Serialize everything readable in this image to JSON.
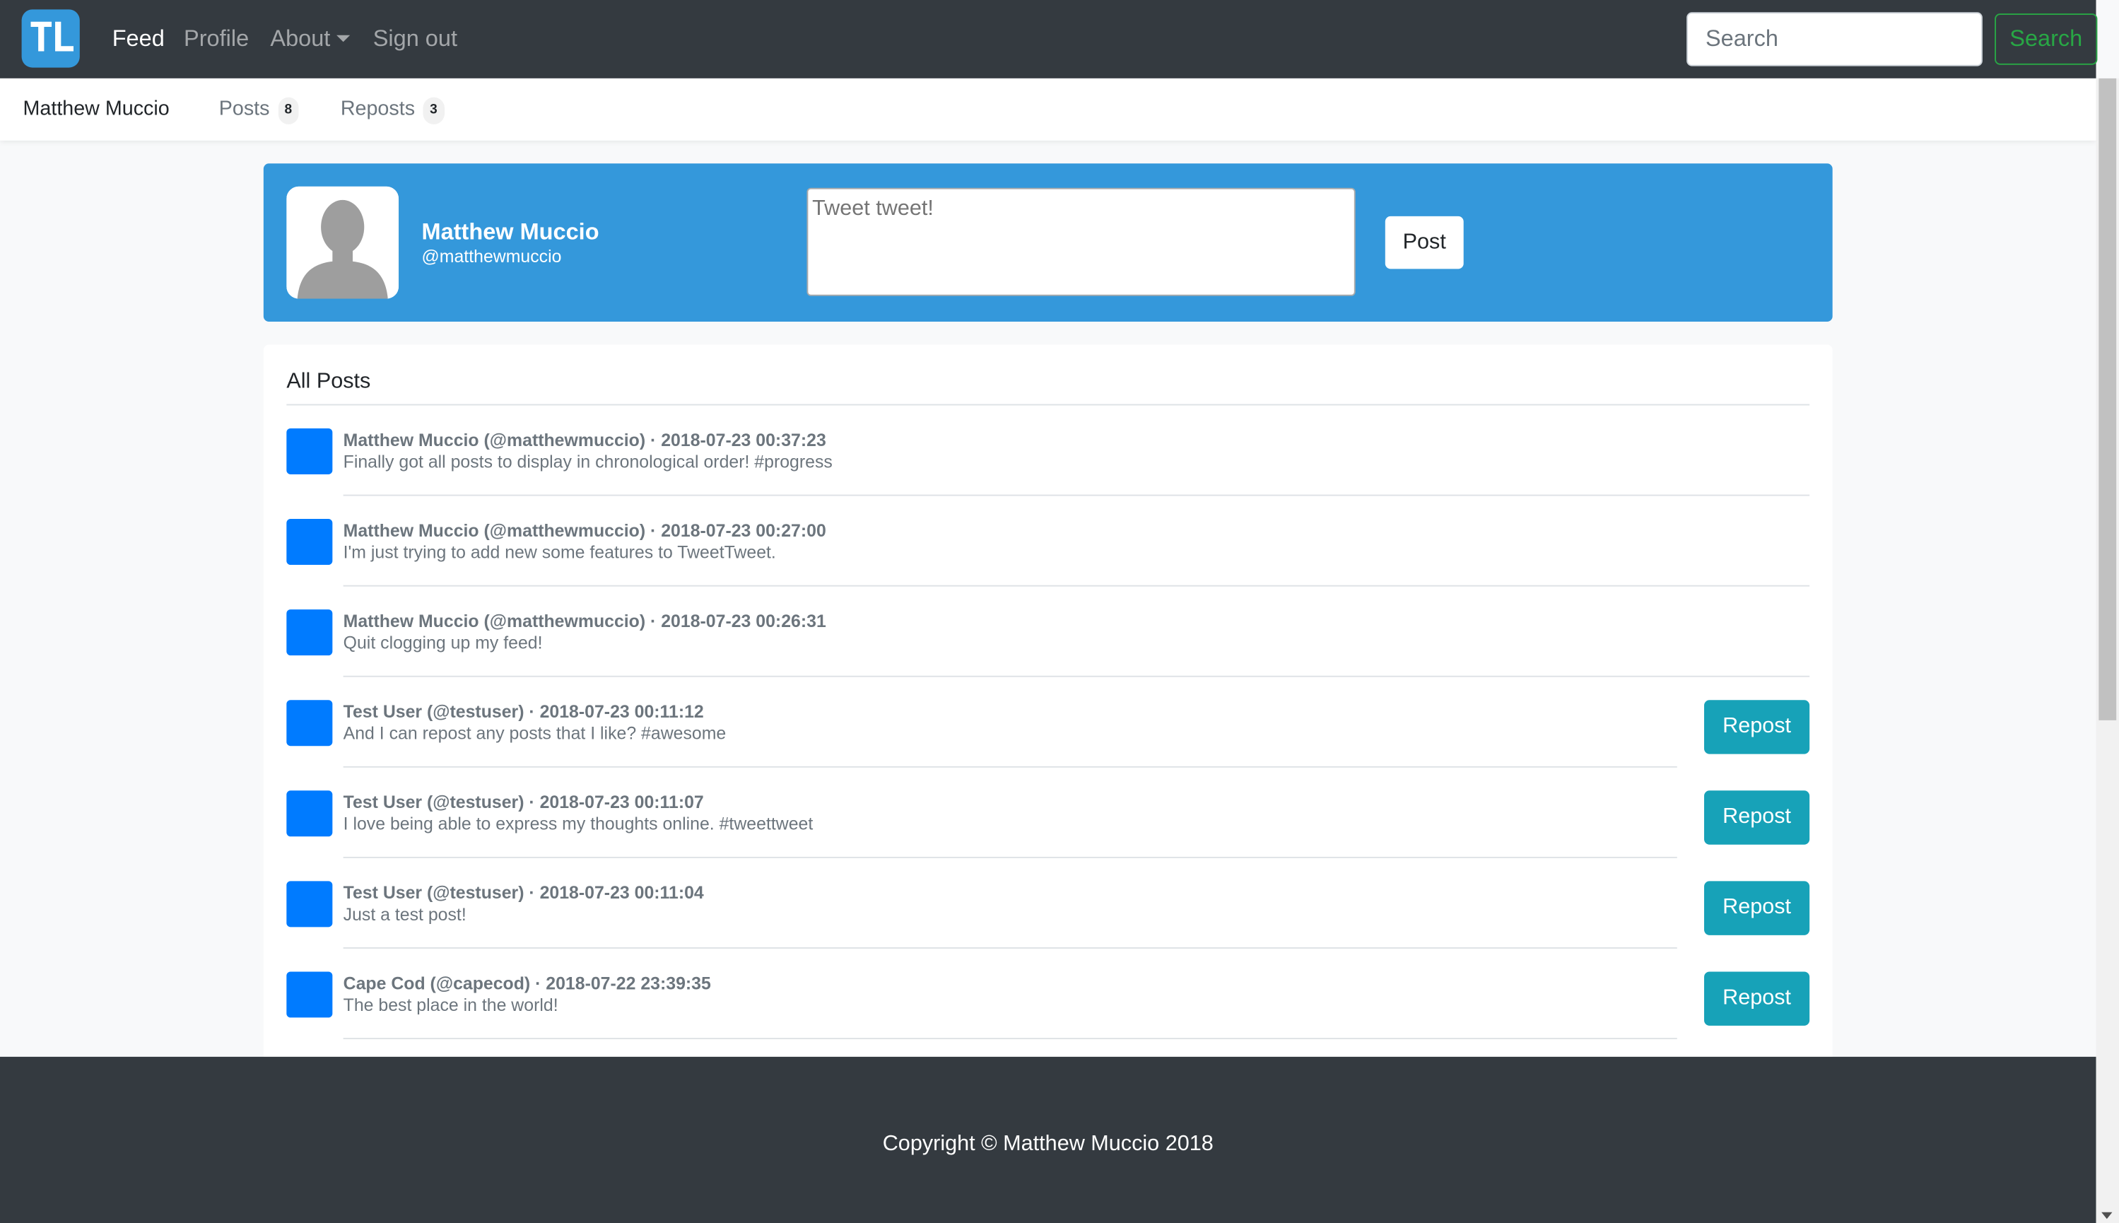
{
  "navbar": {
    "logo_text": "TL",
    "links": [
      "Feed",
      "Profile",
      "About",
      "Sign out"
    ],
    "search_placeholder": "Search",
    "search_button": "Search"
  },
  "subnav": {
    "name": "Matthew Muccio",
    "posts_label": "Posts",
    "posts_count": "8",
    "reposts_label": "Reposts",
    "reposts_count": "3"
  },
  "profile": {
    "name": "Matthew Muccio",
    "handle": "@matthewmuccio",
    "tweet_placeholder": "Tweet tweet!",
    "post_button": "Post",
    "banner_color": "#3498db"
  },
  "feed": {
    "title": "All Posts",
    "repost_label": "Repost",
    "posts": [
      {
        "meta": "Matthew Muccio (@matthewmuccio) · 2018-07-23 00:37:23",
        "text": "Finally got all posts to display in chronological order! #progress",
        "repostable": false
      },
      {
        "meta": "Matthew Muccio (@matthewmuccio) · 2018-07-23 00:27:00",
        "text": "I'm just trying to add new some features to TweetTweet.",
        "repostable": false
      },
      {
        "meta": "Matthew Muccio (@matthewmuccio) · 2018-07-23 00:26:31",
        "text": "Quit clogging up my feed!",
        "repostable": false
      },
      {
        "meta": "Test User (@testuser) · 2018-07-23 00:11:12",
        "text": "And I can repost any posts that I like? #awesome",
        "repostable": true
      },
      {
        "meta": "Test User (@testuser) · 2018-07-23 00:11:07",
        "text": "I love being able to express my thoughts online. #tweettweet",
        "repostable": true
      },
      {
        "meta": "Test User (@testuser) · 2018-07-23 00:11:04",
        "text": "Just a test post!",
        "repostable": true
      },
      {
        "meta": "Cape Cod (@capecod) · 2018-07-22 23:39:35",
        "text": "The best place in the world!",
        "repostable": true
      }
    ]
  },
  "footer": {
    "copyright": "Copyright © Matthew Muccio 2018"
  },
  "colors": {
    "navbar": "#343a40",
    "accent_blue": "#3498db",
    "thumb_blue": "#007bff",
    "repost_teal": "#17a2b8",
    "search_green": "#28a745"
  }
}
